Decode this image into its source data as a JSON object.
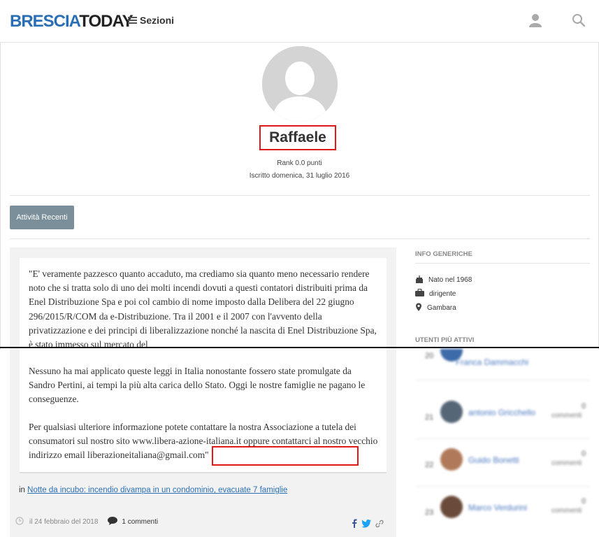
{
  "header": {
    "logo_part1": "BRESCIA",
    "logo_part2": "TODAY",
    "sections_label": "Sezioni",
    "user_icon": "user-icon",
    "search_icon": "search-icon",
    "brand_color": "#2a6fb5"
  },
  "profile": {
    "name": "Raffaele",
    "rank": "Rank 0.0 punti",
    "joined": "Iscritto domenica, 31 luglio 2016",
    "tab_label": "Attività Recenti",
    "highlight_color": "#e01818"
  },
  "comment": {
    "paragraph1": "\"E' veramente pazzesco quanto accaduto, ma crediamo sia quanto meno necessario rendere noto che si tratta solo di uno dei molti incendi dovuti a questi contatori distribuiti prima da Enel Distribuzione Spa e poi col cambio di nome imposto dalla Delibera del 22 giugno 296/2015/R/COM da e-Distribuzione. Tra il 2001 e il 2007 con l'avvento della privatizzazione e dei principi di liberalizzazione nonché la nascita di Enel Distribuzione Spa, è stato immesso sul mercato del",
    "paragraph2": "Nessuno ha mai applicato queste leggi in Italia nonostante fossero state promulgate da Sandro Pertini, ai tempi la più alta carica dello Stato. Oggi le nostre famiglie ne pagano le conseguenze.",
    "paragraph3": "Per qualsiasi ulteriore informazione potete contattare la nostra Associazione a tutela dei consumatori sul nostro sito www.libera-azione-italiana.it oppure contattarci al nostro vecchio indirizzo email liberazioneitaliana@gmail.com\"",
    "in_prefix": "in",
    "article_link": "Notte da incubo: incendio divampa in un condominio, evacuate 7 famiglie",
    "date": "il 24 febbraio del 2018",
    "comments_count": "1 commenti"
  },
  "sidebar": {
    "info_heading": "Info generiche",
    "born": "Nato nel 1968",
    "job": "dirigente",
    "location": "Gambara",
    "active_heading": "Utenti più attivi",
    "users": [
      {
        "rank": "20",
        "name": "Franca Dammacchi",
        "count": "",
        "label": "commenti",
        "color": "#3d6aa8"
      },
      {
        "rank": "21",
        "name": "antonio Gricchello",
        "count": "0",
        "label": "commenti",
        "color": "#556677"
      },
      {
        "rank": "22",
        "name": "Guido Bonetti",
        "count": "0",
        "label": "commenti",
        "color": "#b07a5a"
      },
      {
        "rank": "23",
        "name": "Marco Verdurini",
        "count": "0",
        "label": "commenti",
        "color": "#6a4a3a"
      }
    ]
  }
}
